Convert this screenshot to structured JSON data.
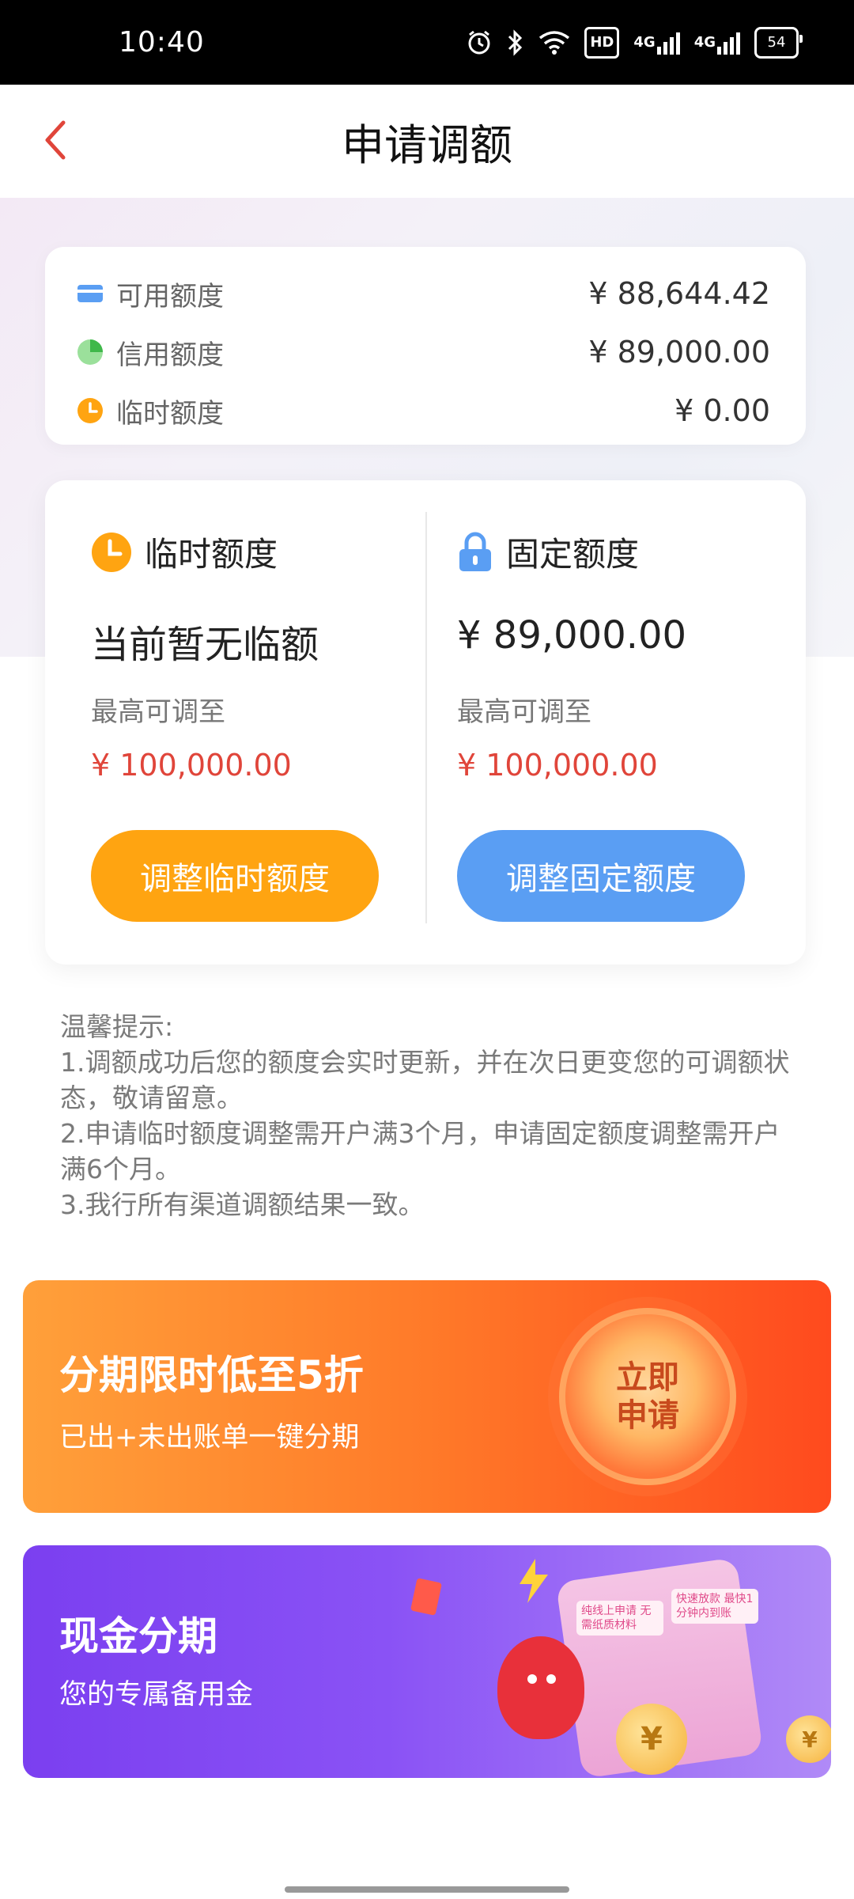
{
  "status_bar": {
    "time": "10:40",
    "hd": "HD",
    "sig1": "4G",
    "sig2": "4G",
    "battery": "54"
  },
  "header": {
    "title": "申请调额"
  },
  "summary": {
    "rows": [
      {
        "label": "可用额度",
        "value": "¥ 88,644.42",
        "icon": "card-icon"
      },
      {
        "label": "信用额度",
        "value": "¥ 89,000.00",
        "icon": "pie-icon"
      },
      {
        "label": "临时额度",
        "value": "¥ 0.00",
        "icon": "clock-icon"
      }
    ]
  },
  "adjust": {
    "temporary": {
      "title": "临时额度",
      "current": "当前暂无临额",
      "max_label": "最高可调至",
      "max_value": "¥ 100,000.00",
      "button": "调整临时额度"
    },
    "fixed": {
      "title": "固定额度",
      "current": "¥ 89,000.00",
      "max_label": "最高可调至",
      "max_value": "¥ 100,000.00",
      "button": "调整固定额度"
    }
  },
  "tips": {
    "heading": "温馨提示:",
    "line1": "1.调额成功后您的额度会实时更新，并在次日更变您的可调额状态，敬请留意。",
    "line2": "2.申请临时额度调整需开户满3个月，申请固定额度调整需开户满6个月。",
    "line3": "3.我行所有渠道调额结果一致。"
  },
  "banners": {
    "installment": {
      "title": "分期限时低至5折",
      "subtitle": "已出+未出账单一键分期",
      "cta": "立即申请"
    },
    "cash": {
      "title": "现金分期",
      "subtitle": "您的专属备用金",
      "tag1": "纯线上申请 无需纸质材料",
      "tag2": "快速放款 最快1分钟内到账"
    }
  },
  "colors": {
    "accent_red": "#e0453a",
    "orange_button": "#ffa411",
    "blue_button": "#5a9ef3"
  }
}
